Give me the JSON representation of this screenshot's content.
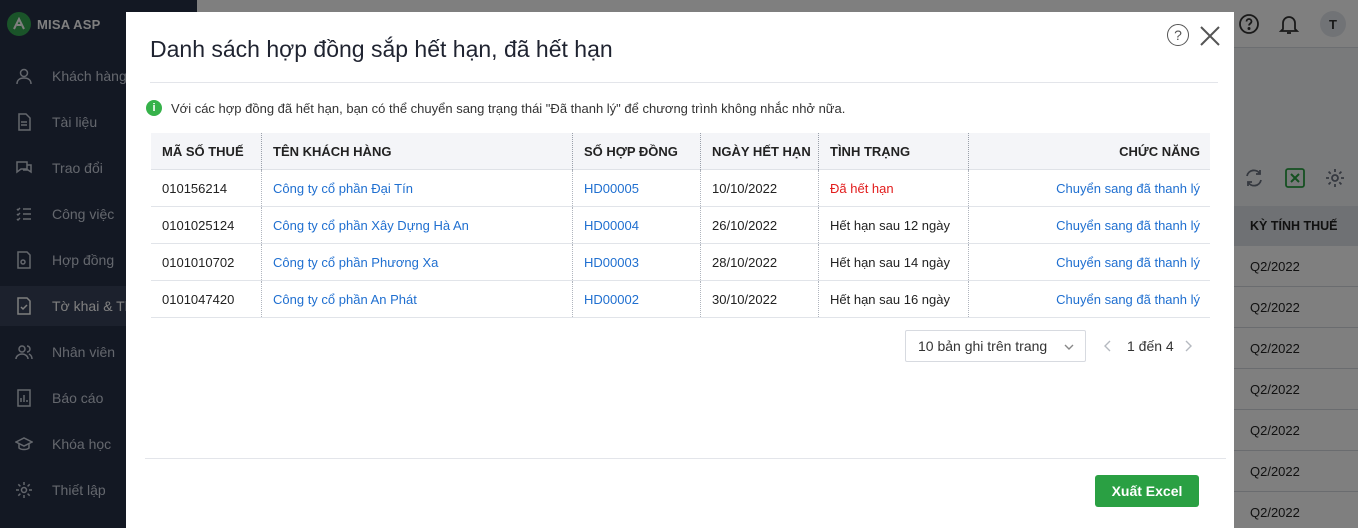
{
  "app": {
    "brand": "MISA ASP",
    "user_initial": "T",
    "sidebar": {
      "items": [
        {
          "label": "Khách hàng",
          "icon": "user-icon"
        },
        {
          "label": "Tài liệu",
          "icon": "document-icon"
        },
        {
          "label": "Trao đổi",
          "icon": "chat-icon"
        },
        {
          "label": "Công việc",
          "icon": "task-list-icon"
        },
        {
          "label": "Hợp đồng",
          "icon": "contract-icon"
        },
        {
          "label": "Tờ khai & Th",
          "icon": "declaration-icon"
        },
        {
          "label": "Nhân viên",
          "icon": "staff-icon"
        },
        {
          "label": "Báo cáo",
          "icon": "report-icon"
        },
        {
          "label": "Khóa học",
          "icon": "graduation-icon"
        },
        {
          "label": "Thiết lập",
          "icon": "gear-icon"
        }
      ]
    },
    "background_table": {
      "column_header": "KỲ TÍNH THUẾ",
      "cells": [
        "Q2/2022",
        "Q2/2022",
        "Q2/2022",
        "Q2/2022",
        "Q2/2022",
        "Q2/2022",
        "Q2/2022",
        "Q2/2022"
      ]
    }
  },
  "dialog": {
    "title": "Danh sách hợp đồng sắp hết hạn, đã hết hạn",
    "notice": "Với các hợp đồng đã hết hạn, bạn có thể chuyển sang trạng thái \"Đã thanh lý\" để chương trình không nhắc nhở nữa.",
    "columns": [
      "MÃ SỐ THUẾ",
      "TÊN KHÁCH HÀNG",
      "SỐ HỢP ĐỒNG",
      "NGÀY HẾT HẠN",
      "TÌNH TRẠNG",
      "CHỨC NĂNG"
    ],
    "rows": [
      {
        "tax_code": "010156214",
        "customer": "Công ty cổ phần Đại Tín",
        "contract": "HD00005",
        "expiry": "10/10/2022",
        "status": "Đã hết hạn",
        "action": "Chuyển sang đã thanh lý"
      },
      {
        "tax_code": "0101025124",
        "customer": "Công ty cổ phần Xây Dựng Hà An",
        "contract": "HD00004",
        "expiry": "26/10/2022",
        "status": "Hết hạn sau 12 ngày",
        "action": "Chuyển sang đã thanh lý"
      },
      {
        "tax_code": "0101010702",
        "customer": "Công ty cổ phần Phương Xa",
        "contract": "HD00003",
        "expiry": "28/10/2022",
        "status": "Hết hạn sau 14 ngày",
        "action": "Chuyển sang đã thanh lý"
      },
      {
        "tax_code": "0101047420",
        "customer": "Công ty cổ phần An Phát",
        "contract": "HD00002",
        "expiry": "30/10/2022",
        "status": "Hết hạn sau 16 ngày",
        "action": "Chuyển sang đã thanh lý"
      }
    ],
    "pager": {
      "page_size": "10 bản ghi trên trang",
      "range": "1 đến 4"
    },
    "export_label": "Xuất Excel",
    "colors": {
      "accent_green": "#2aa043",
      "link_blue": "#1f6fd0",
      "expired_red": "#e21b1b"
    }
  }
}
